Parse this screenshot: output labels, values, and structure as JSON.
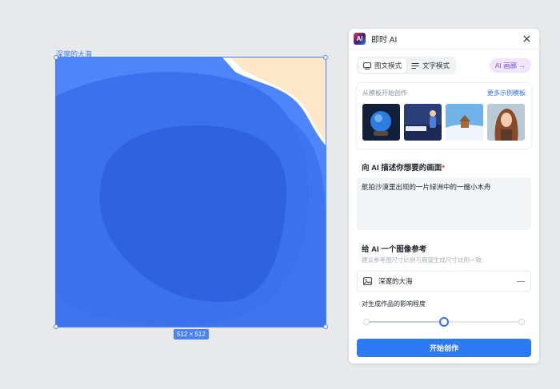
{
  "canvas": {
    "frame_label": "深邃的大海",
    "size_label": "512 × 512"
  },
  "panel": {
    "title": "即时 AI",
    "logo_text": "AI",
    "modes": [
      {
        "label": "图文模式",
        "icon": "image-text-icon",
        "active": true
      },
      {
        "label": "文字模式",
        "icon": "text-lines-icon",
        "active": false
      }
    ],
    "ai_link": "AI 画廊 →",
    "templates": {
      "title": "从模板开始创作",
      "more_link": "更多示例模板",
      "items": [
        "crystal-ball-thumb",
        "pianist-thumb",
        "snow-cabin-thumb",
        "portrait-thumb"
      ]
    },
    "prompt_section": {
      "title": "向 AI 描述你想要的画面",
      "required_mark": "*",
      "value": "航拍沙漠里出现的一片绿洲中的一艘小木舟"
    },
    "reference_section": {
      "title": "给 AI 一个图像参考",
      "subtitle": "建议参考图尺寸比例与期望生成尺寸比例一致",
      "image_name": "深邃的大海",
      "remove_label": "—"
    },
    "influence": {
      "label": "对生成作品的影响程度",
      "level": 0.5
    },
    "start_button": "开始创作"
  },
  "colors": {
    "accent": "#2d7bf4",
    "ocean_light": "#4d85fb",
    "ocean_mid": "#3a72ee",
    "ocean_deep": "#2f62e0",
    "sand": "#fde7c8"
  }
}
